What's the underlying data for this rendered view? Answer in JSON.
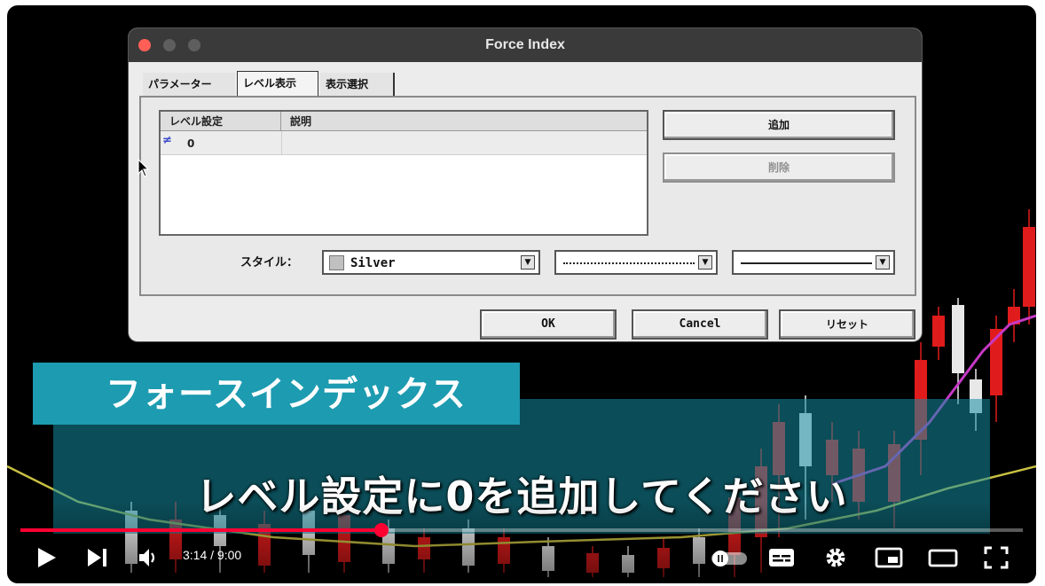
{
  "dialog": {
    "title": "Force Index",
    "tabs": [
      {
        "label": "パラメーター"
      },
      {
        "label": "レベル表示"
      },
      {
        "label": "表示選択"
      }
    ],
    "table": {
      "headers": [
        "レベル設定",
        "説明"
      ],
      "rows": [
        {
          "level": "0",
          "description": ""
        }
      ]
    },
    "add_label": "追加",
    "delete_label": "削除",
    "style_label": "スタイル：",
    "color_value": "Silver",
    "ok_label": "OK",
    "cancel_label": "Cancel",
    "reset_label": "リセット"
  },
  "captions": {
    "title": "フォースインデックス",
    "subtitle": "レベル設定に0を追加してください"
  },
  "player": {
    "time": "3:14 / 9:00",
    "progress": 0.36,
    "accent": "#ff0033"
  },
  "colors": {
    "caption_banner": "#1d9bb0",
    "up_candle": "#e8e8e8",
    "down_candle": "#e01b1b"
  }
}
